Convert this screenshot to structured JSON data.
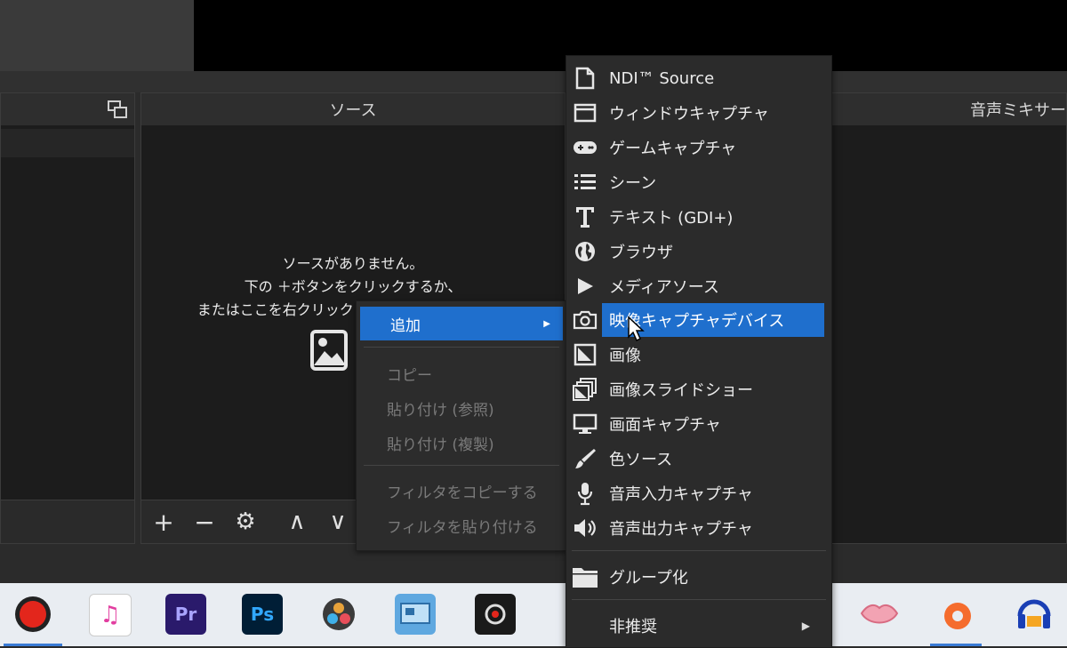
{
  "docks": {
    "sources_title": "ソース",
    "mixer_title": "音声ミキサー"
  },
  "sources": {
    "empty_line1": "ソースがありません。",
    "empty_line2": "下の ＋ボタンをクリックするか、",
    "empty_line3": "またはここを右クリックして追加してください。"
  },
  "toolbar": {
    "add": "+",
    "remove": "−",
    "settings": "⚙",
    "up": "∧",
    "down": "∨"
  },
  "context_menu": {
    "items": [
      {
        "label": "追加",
        "has_submenu": true,
        "active": true,
        "enabled": true
      },
      {
        "label": "コピー",
        "enabled": false
      },
      {
        "label": "貼り付け (参照)",
        "enabled": false
      },
      {
        "label": "貼り付け (複製)",
        "enabled": false
      },
      {
        "label": "フィルタをコピーする",
        "enabled": false
      },
      {
        "label": "フィルタを貼り付ける",
        "enabled": false
      }
    ]
  },
  "sub_menu": {
    "items": [
      {
        "label": "NDI™ Source",
        "icon": "file-icon"
      },
      {
        "label": "ウィンドウキャプチャ",
        "icon": "window-icon"
      },
      {
        "label": "ゲームキャプチャ",
        "icon": "gamepad-icon"
      },
      {
        "label": "シーン",
        "icon": "list-icon"
      },
      {
        "label": "テキスト (GDI+)",
        "icon": "text-icon"
      },
      {
        "label": "ブラウザ",
        "icon": "globe-icon"
      },
      {
        "label": "メディアソース",
        "icon": "play-icon"
      },
      {
        "label": "映像キャプチャデバイス",
        "icon": "camera-icon",
        "active": true
      },
      {
        "label": "画像",
        "icon": "image-icon"
      },
      {
        "label": "画像スライドショー",
        "icon": "slideshow-icon"
      },
      {
        "label": "画面キャプチャ",
        "icon": "monitor-icon"
      },
      {
        "label": "色ソース",
        "icon": "brush-icon"
      },
      {
        "label": "音声入力キャプチャ",
        "icon": "microphone-icon"
      },
      {
        "label": "音声出力キャプチャ",
        "icon": "speaker-icon"
      },
      {
        "label": "グループ化",
        "icon": "folder-icon"
      },
      {
        "label": "非推奨",
        "icon": "",
        "has_submenu": true
      }
    ]
  },
  "taskbar": {
    "apps": [
      {
        "name": "obs-studio-icon",
        "label": ""
      },
      {
        "name": "itunes-icon",
        "label": "♫"
      },
      {
        "name": "premiere-pro-icon",
        "label": "Pr"
      },
      {
        "name": "photoshop-icon",
        "label": "Ps"
      },
      {
        "name": "davinci-resolve-icon",
        "label": ""
      },
      {
        "name": "control-panel-icon",
        "label": ""
      },
      {
        "name": "record-app-icon",
        "label": ""
      },
      {
        "name": "lips-app-icon",
        "label": ""
      },
      {
        "name": "origin-icon",
        "label": ""
      },
      {
        "name": "audacity-icon",
        "label": ""
      }
    ]
  },
  "colors": {
    "menu_highlight": "#1f6fcd",
    "premiere": "#2a1a6b",
    "premiere_text": "#a9a4ff",
    "photoshop": "#001e36",
    "photoshop_text": "#31a8ff"
  }
}
